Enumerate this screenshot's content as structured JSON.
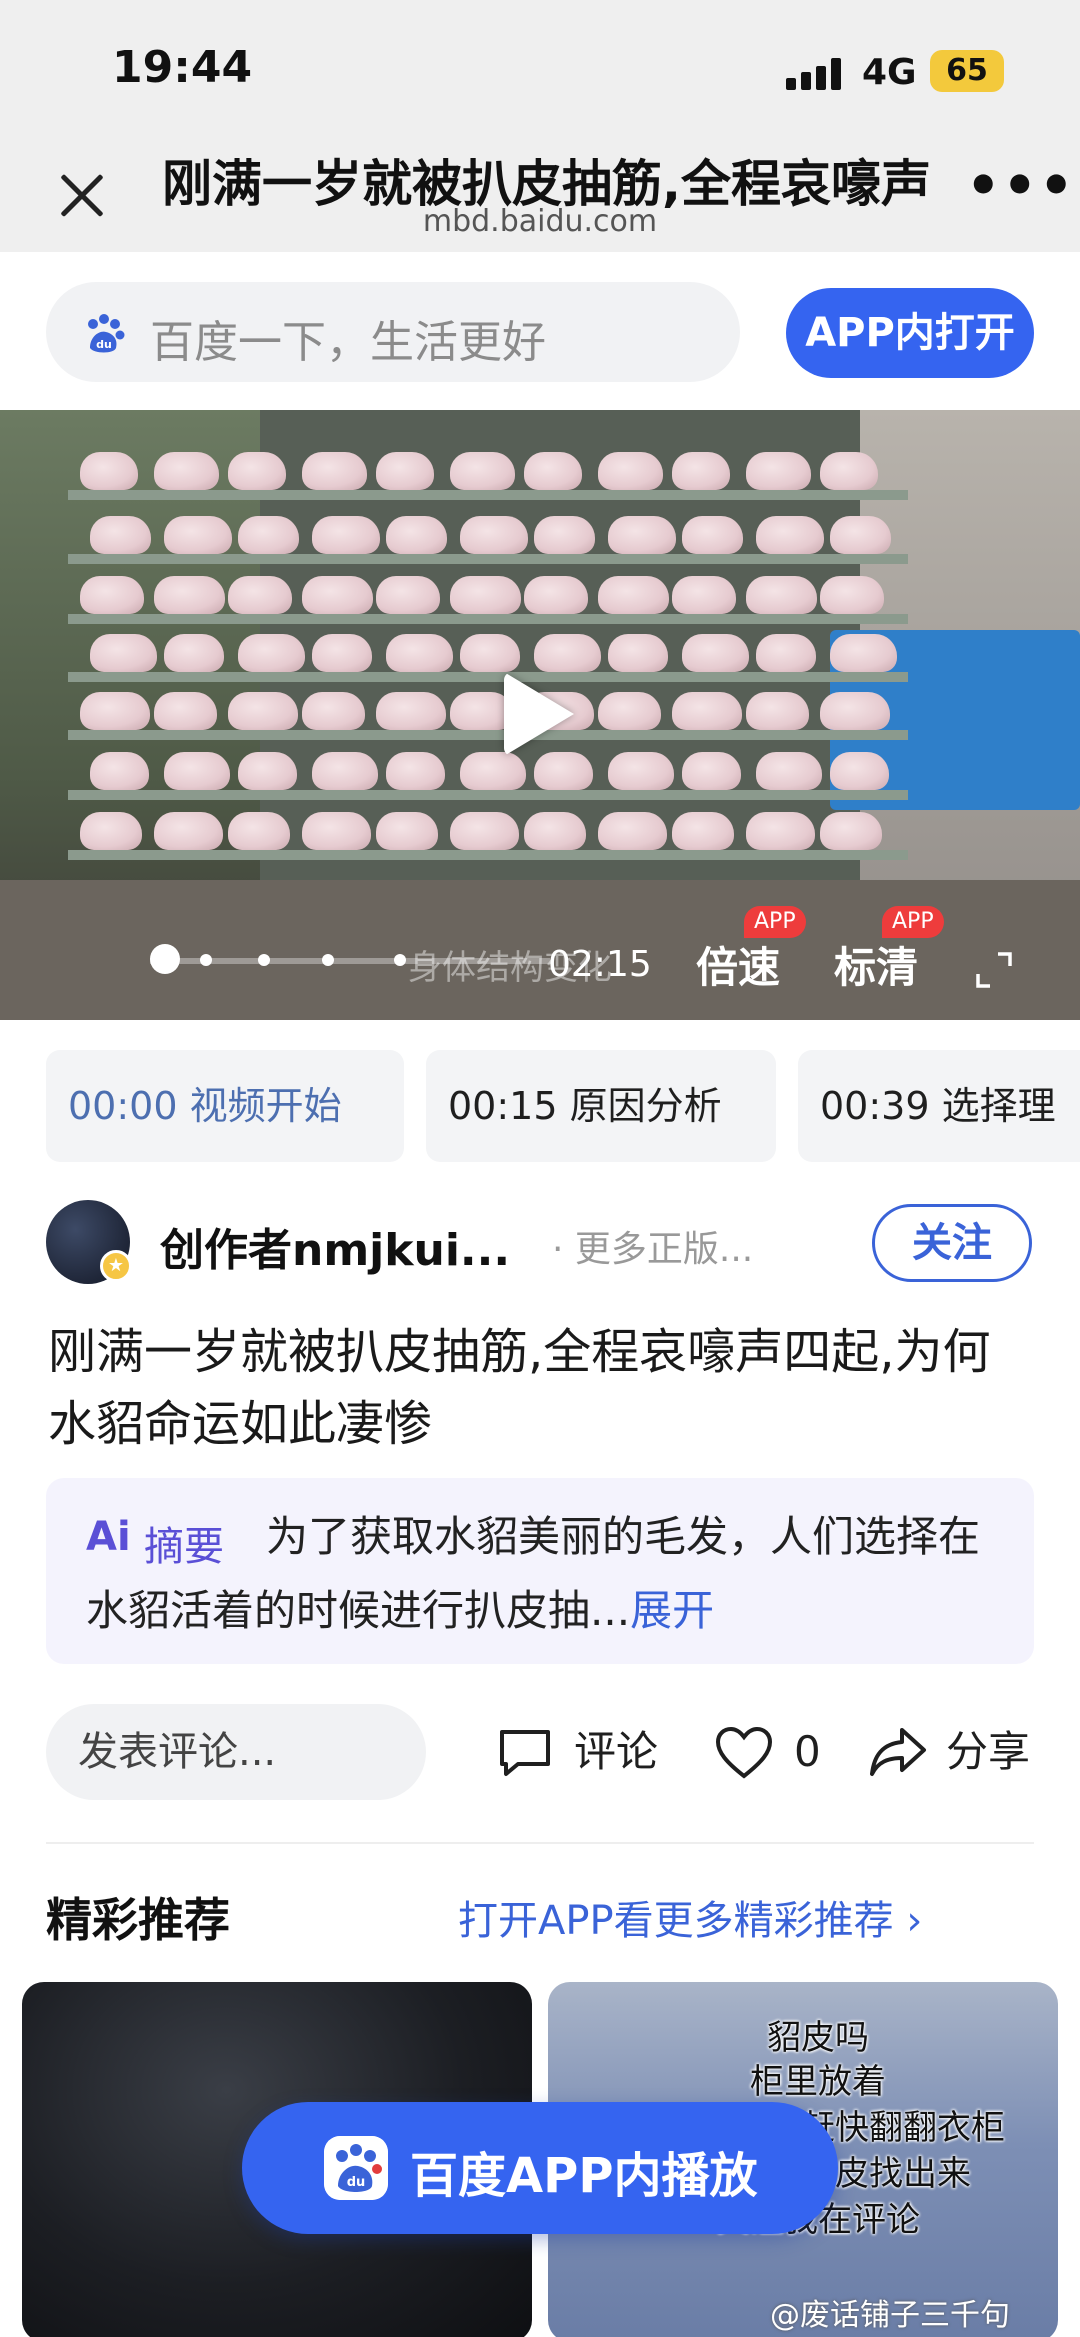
{
  "status_bar": {
    "time": "19:44",
    "network": "4G",
    "battery": "65"
  },
  "title_bar": {
    "title": "刚满一岁就被扒皮抽筋,全程哀嚎声四起,为何水貂命运如此凄惨",
    "url": "mbd.baidu.com",
    "more": "•••"
  },
  "search": {
    "placeholder": "百度一下，生活更好",
    "app_open_label": "APP内打开"
  },
  "video": {
    "watermark": "身体结构变化",
    "duration": "02:15",
    "speed_label": "倍速",
    "quality_label": "标清",
    "app_badge": "APP"
  },
  "chapters": [
    {
      "time": "00:00",
      "label": "视频开始"
    },
    {
      "time": "00:15",
      "label": "原因分析"
    },
    {
      "time": "00:39",
      "label": "选择理"
    }
  ],
  "author": {
    "name": "创作者nmjkui...",
    "extra": "· 更多正版...",
    "follow_label": "关注"
  },
  "video_title": "刚满一岁就被扒皮抽筋,全程哀嚎声四起,为何水貂命运如此凄惨",
  "summary": {
    "ai_mark": "Ai",
    "label": "摘要",
    "text": "为了获取水貂美丽的毛发，人们选择在水貂活着的时候进行扒皮抽...",
    "expand_label": "展开"
  },
  "actions": {
    "comment_placeholder": "发表评论...",
    "comment_label": "评论",
    "like_count": "0",
    "share_label": "分享"
  },
  "recommend": {
    "title": "精彩推荐",
    "link": "打开APP看更多精彩推荐 ›",
    "card_right_caption": [
      "貂皮吗",
      "柜里放着",
      "如果你有就赶快翻翻衣柜",
      "把不穿的貂皮找出来",
      "关注我在评论"
    ]
  },
  "float_button": {
    "label": "百度APP内播放"
  },
  "footer_watermark": "@废话铺子三千句",
  "colors": {
    "accent": "#3564f0",
    "link": "#3a63d8",
    "ai": "#5a4fd6",
    "badge": "#ee3c3c"
  }
}
